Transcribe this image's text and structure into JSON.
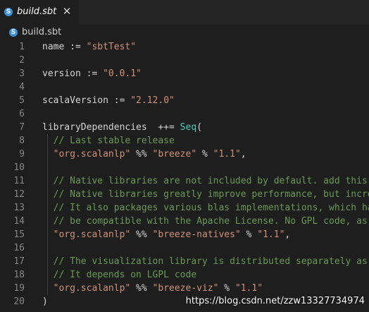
{
  "tab": {
    "icon": "sbt-file-icon",
    "icon_glyph": "S",
    "label": "build.sbt",
    "close_glyph": "✕"
  },
  "breadcrumb": {
    "icon": "sbt-file-icon",
    "icon_glyph": "S",
    "label": "build.sbt"
  },
  "editor": {
    "lines": [
      {
        "n": "1",
        "tokens": [
          {
            "t": "name := ",
            "c": "plain"
          },
          {
            "t": "\"sbtTest\"",
            "c": "str"
          }
        ]
      },
      {
        "n": "2",
        "tokens": []
      },
      {
        "n": "3",
        "tokens": [
          {
            "t": "version := ",
            "c": "plain"
          },
          {
            "t": "\"0.0.1\"",
            "c": "str"
          }
        ]
      },
      {
        "n": "4",
        "tokens": []
      },
      {
        "n": "5",
        "tokens": [
          {
            "t": "scalaVersion := ",
            "c": "plain"
          },
          {
            "t": "\"2.12.0\"",
            "c": "str"
          }
        ]
      },
      {
        "n": "6",
        "tokens": []
      },
      {
        "n": "7",
        "tokens": [
          {
            "t": "libraryDependencies  ++= ",
            "c": "plain"
          },
          {
            "t": "Seq",
            "c": "kw"
          },
          {
            "t": "(",
            "c": "plain"
          }
        ]
      },
      {
        "n": "8",
        "tokens": [
          {
            "t": "  // Last stable release",
            "c": "cmt"
          }
        ]
      },
      {
        "n": "9",
        "tokens": [
          {
            "t": "  ",
            "c": "plain"
          },
          {
            "t": "\"org.scalanlp\"",
            "c": "str"
          },
          {
            "t": " %% ",
            "c": "plain"
          },
          {
            "t": "\"breeze\"",
            "c": "str"
          },
          {
            "t": " % ",
            "c": "plain"
          },
          {
            "t": "\"1.1\"",
            "c": "str"
          },
          {
            "t": ",",
            "c": "plain"
          }
        ]
      },
      {
        "n": "10",
        "tokens": []
      },
      {
        "n": "11",
        "tokens": [
          {
            "t": "  // Native libraries are not included by default. add this",
            "c": "cmt"
          }
        ]
      },
      {
        "n": "12",
        "tokens": [
          {
            "t": "  // Native libraries greatly improve performance, but incre",
            "c": "cmt"
          }
        ]
      },
      {
        "n": "13",
        "tokens": [
          {
            "t": "  // It also packages various blas implementations, which ha",
            "c": "cmt"
          }
        ]
      },
      {
        "n": "14",
        "tokens": [
          {
            "t": "  // be compatible with the Apache License. No GPL code, as",
            "c": "cmt"
          }
        ]
      },
      {
        "n": "15",
        "tokens": [
          {
            "t": "  ",
            "c": "plain"
          },
          {
            "t": "\"org.scalanlp\"",
            "c": "str"
          },
          {
            "t": " %% ",
            "c": "plain"
          },
          {
            "t": "\"breeze-natives\"",
            "c": "str"
          },
          {
            "t": " % ",
            "c": "plain"
          },
          {
            "t": "\"1.1\"",
            "c": "str"
          },
          {
            "t": ",",
            "c": "plain"
          }
        ]
      },
      {
        "n": "16",
        "tokens": []
      },
      {
        "n": "17",
        "tokens": [
          {
            "t": "  // The visualization library is distributed separately as",
            "c": "cmt"
          }
        ]
      },
      {
        "n": "18",
        "tokens": [
          {
            "t": "  // It depends on LGPL code",
            "c": "cmt"
          }
        ]
      },
      {
        "n": "19",
        "tokens": [
          {
            "t": "  ",
            "c": "plain"
          },
          {
            "t": "\"org.scalanlp\"",
            "c": "str"
          },
          {
            "t": " %% ",
            "c": "plain"
          },
          {
            "t": "\"breeze-viz\"",
            "c": "str"
          },
          {
            "t": " % ",
            "c": "plain"
          },
          {
            "t": "\"1.1\"",
            "c": "str"
          }
        ]
      },
      {
        "n": "20",
        "tokens": [
          {
            "t": ")",
            "c": "plain"
          }
        ]
      }
    ]
  },
  "watermark": "https://blog.csdn.net/zzw13327734974",
  "colors": {
    "background": "#1e1e1e",
    "tabbar": "#252526",
    "string": "#ce9178",
    "comment": "#6a9955",
    "type": "#4ec9b0",
    "text": "#d4d4d4",
    "line_number": "#858585",
    "sbt_icon": "#3c91d6"
  }
}
